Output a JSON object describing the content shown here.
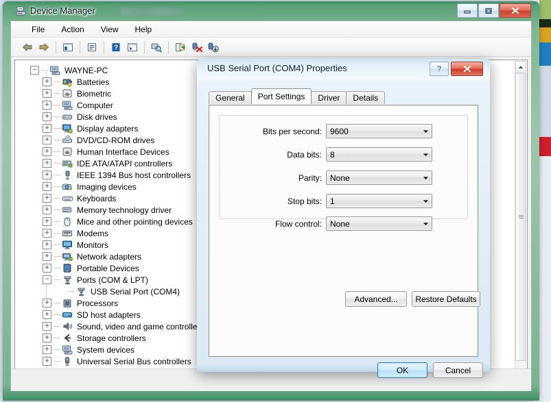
{
  "window": {
    "title": "Device Manager",
    "icon": "device-manager-icon",
    "controls": {
      "minimize": "Minimize",
      "maximize": "Maximize",
      "close": "Close"
    }
  },
  "menubar": {
    "items": [
      {
        "label": "File"
      },
      {
        "label": "Action"
      },
      {
        "label": "View"
      },
      {
        "label": "Help"
      }
    ]
  },
  "toolbar": {
    "buttons": [
      {
        "name": "back-icon",
        "tooltip": "Back"
      },
      {
        "name": "forward-icon",
        "tooltip": "Forward"
      },
      {
        "name": "show-hide-console-tree-icon",
        "tooltip": "Show/Hide Console Tree"
      },
      {
        "name": "properties-icon",
        "tooltip": "Properties"
      },
      {
        "name": "help-icon",
        "tooltip": "Help"
      },
      {
        "name": "view-icon",
        "tooltip": "View"
      },
      {
        "name": "scan-for-hardware-changes-icon",
        "tooltip": "Scan for hardware changes"
      },
      {
        "name": "update-driver-software-icon",
        "tooltip": "Update Driver Software"
      },
      {
        "name": "uninstall-device-icon",
        "tooltip": "Uninstall"
      },
      {
        "name": "disable-device-icon",
        "tooltip": "Disable"
      }
    ]
  },
  "tree": {
    "root": {
      "label": "WAYNE-PC",
      "expander": "minus",
      "icon": "computer-icon"
    },
    "items": [
      {
        "label": "Batteries",
        "expander": "plus",
        "icon": "battery-icon"
      },
      {
        "label": "Biometric",
        "expander": "plus",
        "icon": "biometric-icon"
      },
      {
        "label": "Computer",
        "expander": "plus",
        "icon": "computer-icon"
      },
      {
        "label": "Disk drives",
        "expander": "plus",
        "icon": "disk-drive-icon"
      },
      {
        "label": "Display adapters",
        "expander": "plus",
        "icon": "display-adapter-icon"
      },
      {
        "label": "DVD/CD-ROM drives",
        "expander": "plus",
        "icon": "dvd-drive-icon"
      },
      {
        "label": "Human Interface Devices",
        "expander": "plus",
        "icon": "hid-icon"
      },
      {
        "label": "IDE ATA/ATAPI controllers",
        "expander": "plus",
        "icon": "ide-controller-icon"
      },
      {
        "label": "IEEE 1394 Bus host controllers",
        "expander": "plus",
        "icon": "ieee1394-icon"
      },
      {
        "label": "Imaging devices",
        "expander": "plus",
        "icon": "camera-icon"
      },
      {
        "label": "Keyboards",
        "expander": "plus",
        "icon": "keyboard-icon"
      },
      {
        "label": "Memory technology driver",
        "expander": "plus",
        "icon": "memory-icon"
      },
      {
        "label": "Mice and other pointing devices",
        "expander": "plus",
        "icon": "mouse-icon"
      },
      {
        "label": "Modems",
        "expander": "plus",
        "icon": "modem-icon"
      },
      {
        "label": "Monitors",
        "expander": "plus",
        "icon": "monitor-icon"
      },
      {
        "label": "Network adapters",
        "expander": "plus",
        "icon": "network-adapter-icon"
      },
      {
        "label": "Portable Devices",
        "expander": "plus",
        "icon": "portable-device-icon"
      },
      {
        "label": "Ports (COM & LPT)",
        "expander": "minus",
        "icon": "port-icon"
      },
      {
        "label": "USB Serial Port (COM4)",
        "expander": "none",
        "icon": "port-icon",
        "child": true
      },
      {
        "label": "Processors",
        "expander": "plus",
        "icon": "processor-icon"
      },
      {
        "label": "SD host adapters",
        "expander": "plus",
        "icon": "sd-adapter-icon"
      },
      {
        "label": "Sound, video and game controllers",
        "expander": "plus",
        "icon": "sound-icon"
      },
      {
        "label": "Storage controllers",
        "expander": "plus",
        "icon": "storage-controller-icon"
      },
      {
        "label": "System devices",
        "expander": "plus",
        "icon": "system-device-icon"
      },
      {
        "label": "Universal Serial Bus controllers",
        "expander": "plus",
        "icon": "usb-icon"
      }
    ]
  },
  "dialog": {
    "title": "USB Serial Port (COM4) Properties",
    "help_label": "?",
    "close_label": "✕",
    "tabs": [
      {
        "label": "General",
        "active": false
      },
      {
        "label": "Port Settings",
        "active": true
      },
      {
        "label": "Driver",
        "active": false
      },
      {
        "label": "Details",
        "active": false
      }
    ],
    "fields": [
      {
        "label": "Bits per second:",
        "value": "9600"
      },
      {
        "label": "Data bits:",
        "value": "8"
      },
      {
        "label": "Parity:",
        "value": "None"
      },
      {
        "label": "Stop bits:",
        "value": "1"
      },
      {
        "label": "Flow control:",
        "value": "None"
      }
    ],
    "buttons": {
      "advanced": "Advanced...",
      "restore_defaults": "Restore Defaults",
      "ok": "OK",
      "cancel": "Cancel"
    }
  },
  "colors": {
    "window_frame": "#3f8f63",
    "dialog_accent": "#3c7fb1",
    "close_button": "#cb3c27",
    "tab_active_bg": "#fcfcfc",
    "tree_bg": "#ffffff"
  }
}
